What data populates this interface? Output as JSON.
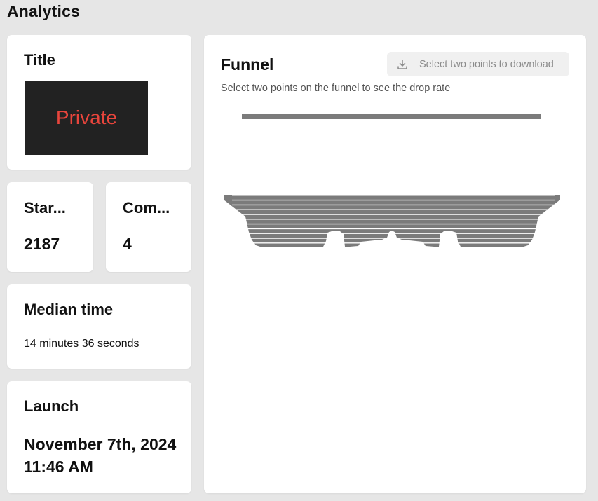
{
  "page": {
    "title": "Analytics"
  },
  "title_card": {
    "heading": "Title",
    "thumbnail_text": "Private"
  },
  "starts_card": {
    "heading": "Star...",
    "value": "2187"
  },
  "completions_card": {
    "heading": "Com...",
    "value": "4"
  },
  "median_card": {
    "heading": "Median time",
    "value": "14 minutes 36 seconds"
  },
  "launch_card": {
    "heading": "Launch",
    "value": "November 7th, 2024 11:46 AM"
  },
  "funnel_card": {
    "title": "Funnel",
    "download_label": "Select two points to download",
    "download_icon": "download-icon",
    "subtitle": "Select two points on the funnel to see the drop rate"
  },
  "colors": {
    "background": "#e6e6e6",
    "card": "#ffffff",
    "private_text": "#e8453c",
    "thumbnail_bg": "#222222",
    "funnel_fill": "#7b7b7b"
  }
}
